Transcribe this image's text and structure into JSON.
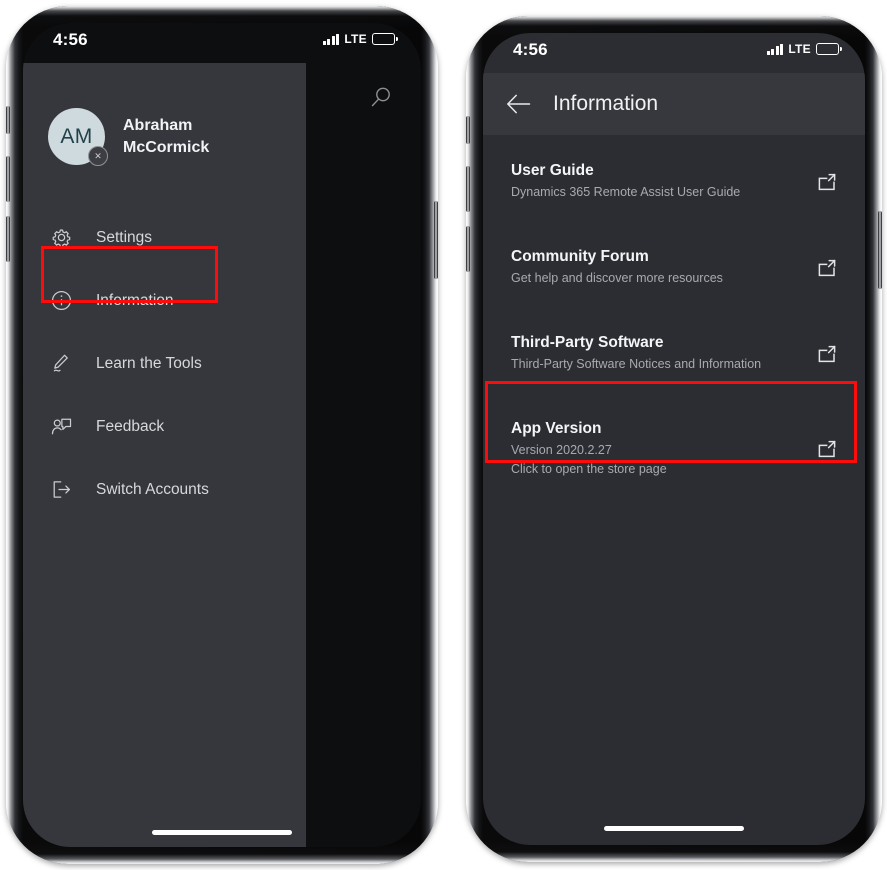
{
  "phones": {
    "left": {
      "status": {
        "time": "4:56",
        "network": "LTE",
        "signal_icon": "signal-bars-icon",
        "battery_icon": "battery-icon"
      },
      "drawer": {
        "search_icon": "search-icon",
        "profile": {
          "initials": "AM",
          "name": "Abraham\nMcCormick",
          "badge_icon": "presence-offline-icon"
        },
        "menu": [
          {
            "label": "Settings",
            "icon": "gear-icon",
            "highlighted": false
          },
          {
            "label": "Information",
            "icon": "info-circle-icon",
            "highlighted": true
          },
          {
            "label": "Learn the Tools",
            "icon": "ink-pen-icon",
            "highlighted": false
          },
          {
            "label": "Feedback",
            "icon": "person-feedback-icon",
            "highlighted": false
          },
          {
            "label": "Switch Accounts",
            "icon": "sign-out-icon",
            "highlighted": false
          }
        ]
      }
    },
    "right": {
      "status": {
        "time": "4:56",
        "network": "LTE",
        "signal_icon": "signal-bars-icon",
        "battery_icon": "battery-icon"
      },
      "header": {
        "title": "Information",
        "back_icon": "back-arrow-icon"
      },
      "rows": [
        {
          "title": "User Guide",
          "subtitle": "Dynamics 365 Remote Assist User Guide",
          "icon": "external-link-icon",
          "highlighted": false
        },
        {
          "title": "Community Forum",
          "subtitle": "Get help and discover more resources",
          "icon": "external-link-icon",
          "highlighted": false
        },
        {
          "title": "Third-Party Software",
          "subtitle": "Third-Party Software Notices and Information",
          "icon": "external-link-icon",
          "highlighted": false
        },
        {
          "title": "App Version",
          "subtitle": "Version 2020.2.27\nClick to open the store page",
          "icon": "external-link-icon",
          "highlighted": true
        }
      ]
    }
  },
  "annotation": {
    "color": "#fd0c0c",
    "boxes": [
      {
        "target": "sidebar-item-information"
      },
      {
        "target": "info-row-app-version"
      }
    ]
  },
  "colors": {
    "drawer_bg": "#35373c",
    "scrim_bg": "#0d0e10",
    "page_bg": "#2b2d32",
    "header_bg": "#36383d",
    "avatar_bg": "#cfdade",
    "avatar_fg": "#214249",
    "accent_red": "#fd0c0c"
  }
}
